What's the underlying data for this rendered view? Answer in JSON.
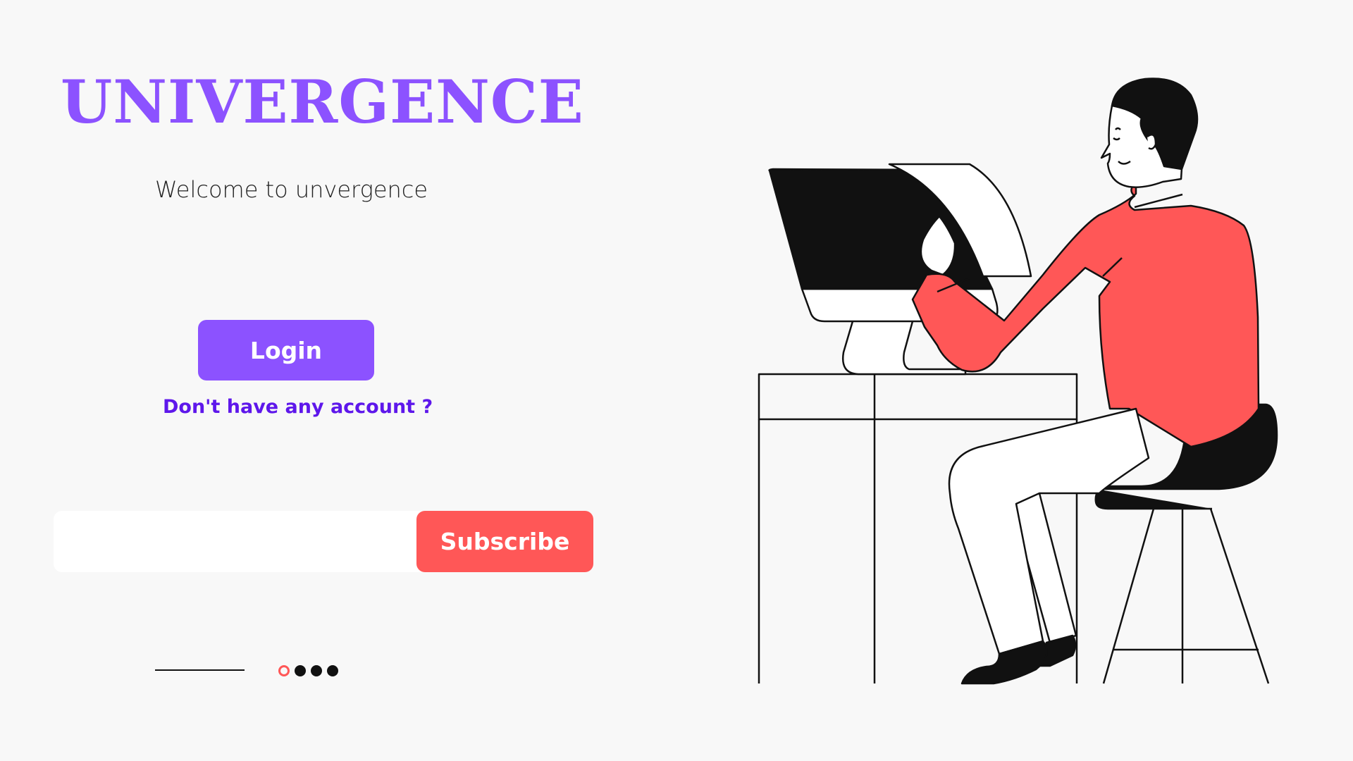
{
  "brand": {
    "title": "UNIVERGENCE",
    "tagline": "Welcome to unvergence"
  },
  "auth": {
    "login_label": "Login",
    "signup_link": "Don't have any account ?"
  },
  "subscribe": {
    "input_value": "",
    "input_placeholder": "",
    "button_label": "Subscribe"
  },
  "pager": {
    "total_pages": 4,
    "active_index": 0
  },
  "illustration": {
    "icon": "person-at-computer-desk-illustration"
  },
  "colors": {
    "background": "#f8f8f8",
    "brand_purple": "#8c52ff",
    "link_purple": "#5e17eb",
    "accent_coral": "#ff5757",
    "ink": "#111111"
  }
}
